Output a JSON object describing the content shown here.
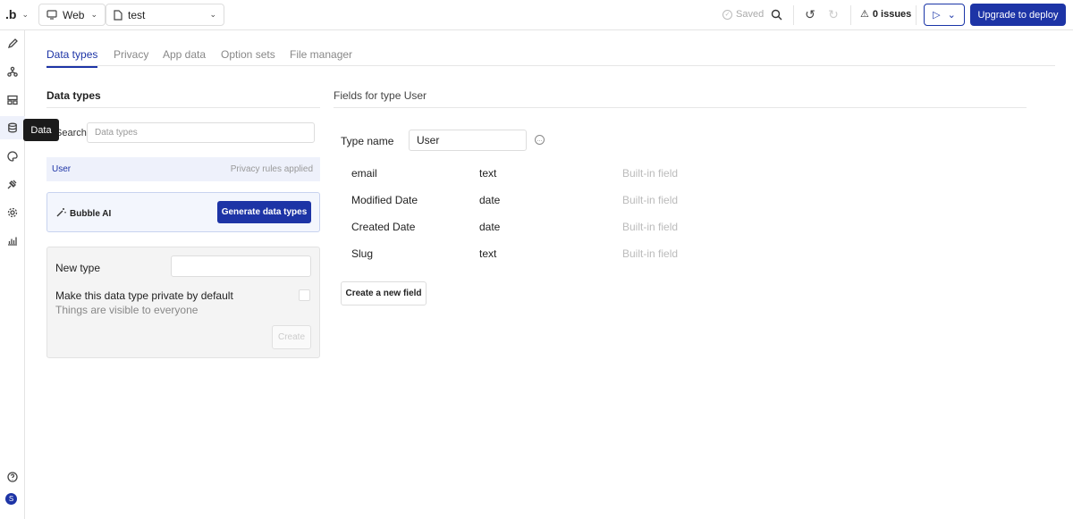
{
  "topbar": {
    "logo": ".b",
    "platform": "Web",
    "page": "test",
    "saved": "Saved",
    "issues": "0 issues",
    "deploy": "Upgrade to deploy"
  },
  "sidebar": {
    "tooltip": "Data",
    "avatar": "S"
  },
  "tabs": [
    "Data types",
    "Privacy",
    "App data",
    "Option sets",
    "File manager"
  ],
  "data_types_panel": {
    "title": "Data types",
    "search_label": "Search",
    "search_placeholder": "Data types",
    "types": [
      {
        "name": "User",
        "privacy": "Privacy rules applied"
      }
    ],
    "ai_label": "Bubble AI",
    "ai_button": "Generate data types",
    "new_type_label": "New type",
    "private_label": "Make this data type private by default",
    "private_sub": "Things are visible to everyone",
    "create_button": "Create"
  },
  "fields_panel": {
    "title": "Fields for type User",
    "type_name_label": "Type name",
    "type_name_value": "User",
    "fields": [
      {
        "name": "email",
        "type": "text",
        "note": "Built-in field"
      },
      {
        "name": "Modified Date",
        "type": "date",
        "note": "Built-in field"
      },
      {
        "name": "Created Date",
        "type": "date",
        "note": "Built-in field"
      },
      {
        "name": "Slug",
        "type": "text",
        "note": "Built-in field"
      }
    ],
    "new_field_button": "Create a new field"
  },
  "colors": {
    "accent": "#1d34a6",
    "selected_bg": "#eef1fb"
  }
}
